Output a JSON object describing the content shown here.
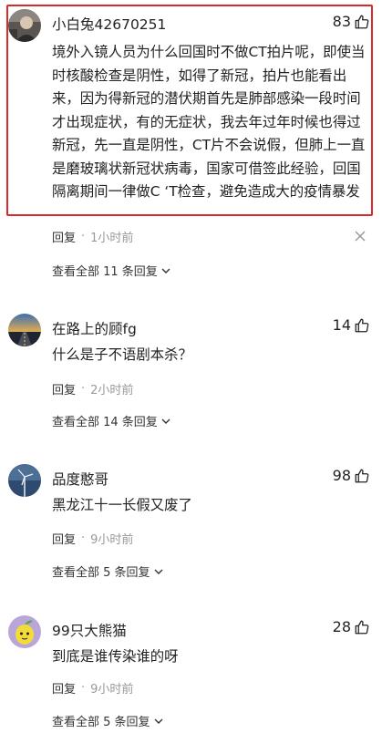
{
  "comments": [
    {
      "username": "小白兔42670251",
      "likes": "83",
      "text": "境外入镜人员为什么回国时不做CT拍片呢，即使当时核酸检查是阴性，如得了新冠，拍片也能看出来，因为得新冠的潜伏期首先是肺部感染一段时间才出现症状，有的无症状，我去年过年时候也得过新冠，先一直是阴性，CT片不会说假，但肺上一直是磨玻璃状新冠状病毒，国家可借签此经验，回国隔离期间一律做C ‘T检查，避免造成大的疫情暴发",
      "reply_label": "回复",
      "time": "1小时前",
      "replies_label": "查看全部 11 条回复",
      "avatar_icon": "dark-portrait-avatar"
    },
    {
      "username": "在路上的顾fg",
      "likes": "14",
      "text": "什么是子不语剧本杀？",
      "reply_label": "回复",
      "time": "2小时前",
      "replies_label": "查看全部 14 条回复",
      "avatar_icon": "road-sunset-avatar"
    },
    {
      "username": "品度憨哥",
      "likes": "98",
      "text": "黑龙江十一长假又废了",
      "reply_label": "回复",
      "time": "9小时前",
      "replies_label": "查看全部 5 条回复",
      "avatar_icon": "windmill-avatar"
    },
    {
      "username": "99只大熊猫",
      "likes": "28",
      "text": "到底是谁传染谁的呀",
      "reply_label": "回复",
      "time": "9小时前",
      "replies_label": "查看全部 5 条回复",
      "avatar_icon": "cartoon-lemon-avatar"
    }
  ],
  "colors": {
    "highlight_border": "#d62b2b",
    "secondary_text": "#999999",
    "primary_text": "#222222"
  }
}
